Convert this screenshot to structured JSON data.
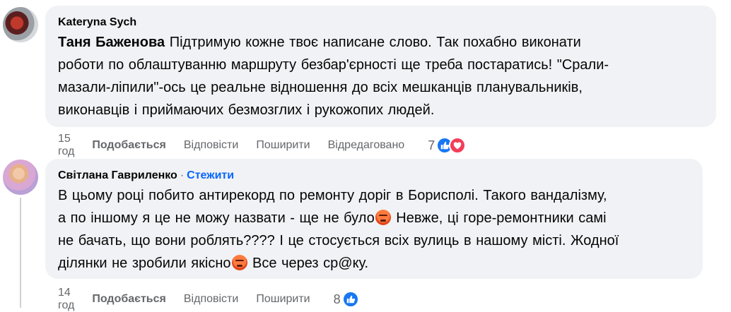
{
  "comments": [
    {
      "author": "Kateryna Sych",
      "mention": "Таня Баженова",
      "text_lines": [
        "Підтримую кожне твоє написане слово. Так похабно виконати",
        "роботи по облаштуванню маршруту безбар'єрності ще треба постаратись! \"Срали-",
        "мазали-ліпили\"-ось це реальне відношення до всіх мешканців планувальників,",
        "виконавців і приймаючих безмозглих і рукожопих людей."
      ],
      "time": "15 год",
      "like_label": "Подобається",
      "reply_label": "Відповісти",
      "share_label": "Поширити",
      "edited_label": "Відредаговано",
      "reaction_count": "7",
      "reactions": [
        "like-icon",
        "love-icon"
      ]
    },
    {
      "author": "Світлана Гавриленко",
      "follow_separator": "·",
      "follow_label": "Стежити",
      "text_lines": [
        "В цьому році побито антирекорд по ремонту доріг в Борисполі. Такого вандалізму,",
        "а по іншому я це не можу назвати - ще не було",
        " Невже, ці горе-ремонтники самі",
        "не бачать, що вони роблять???? І це стосується всіх вулиць в нашому місті. Жодної",
        "ділянки не зробили якісно",
        " Все через ср@ку."
      ],
      "time": "14 год",
      "like_label": "Подобається",
      "reply_label": "Відповісти",
      "share_label": "Поширити",
      "reaction_count": "8",
      "reactions": [
        "like-icon"
      ]
    }
  ],
  "colors": {
    "bubble": "#f0f2f5",
    "meta_text": "#65676b",
    "follow": "#0866ff",
    "like": "#1877f2",
    "love": "#f33e58"
  }
}
